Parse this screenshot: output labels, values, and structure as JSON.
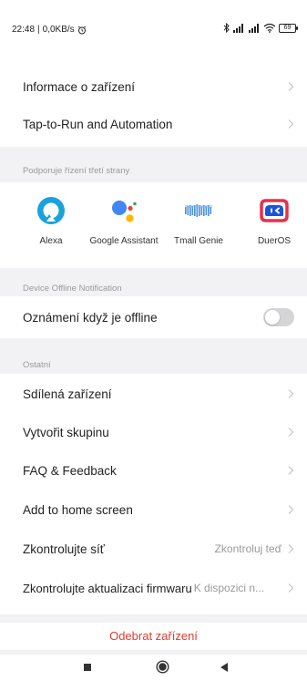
{
  "status_bar": {
    "time": "22:48",
    "network_speed": "0,0KB/s",
    "battery_level": "69",
    "icons": [
      "alarm-icon",
      "bluetooth-icon",
      "signal-icon",
      "signal-icon",
      "wifi-icon",
      "battery-icon"
    ]
  },
  "top_rows": [
    {
      "label": "Informace o zařízení"
    },
    {
      "label": "Tap-to-Run and Automation"
    }
  ],
  "third_party": {
    "header": "Podporuje řízení třetí strany",
    "assistants": [
      {
        "name": "Alexa",
        "icon": "alexa-icon"
      },
      {
        "name": "Google Assistant",
        "icon": "google-assistant-icon"
      },
      {
        "name": "Tmall Genie",
        "icon": "tmall-genie-icon"
      },
      {
        "name": "DuerOS",
        "icon": "dueros-icon"
      }
    ]
  },
  "offline": {
    "header": "Device Offline Notification",
    "label": "Oznámení když je offline",
    "enabled": false
  },
  "other": {
    "header": "Ostatní",
    "rows": [
      {
        "label": "Sdílená zařízení",
        "value": ""
      },
      {
        "label": "Vytvořit skupinu",
        "value": ""
      },
      {
        "label": "FAQ & Feedback",
        "value": ""
      },
      {
        "label": "Add to home screen",
        "value": ""
      },
      {
        "label": "Zkontrolujte síť",
        "value": "Zkontroluj teď"
      },
      {
        "label": "Zkontrolujte aktualizaci firmwaru",
        "value": "K dispozici n..."
      }
    ]
  },
  "remove_device": "Odebrat zařízení",
  "colors": {
    "accent_red": "#e03b32",
    "alexa_blue": "#1aa2dd",
    "dueros_red": "#e8304a"
  }
}
